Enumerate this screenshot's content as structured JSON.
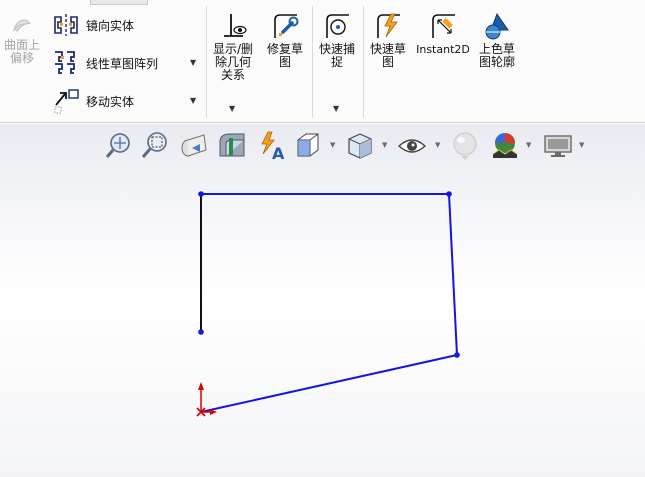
{
  "ribbon": {
    "surface_offset": {
      "label_line1": "曲面上",
      "label_line2": "偏移",
      "enabled": false
    },
    "mirror_entities": {
      "label": "镜向实体"
    },
    "linear_pattern": {
      "label": "线性草图阵列"
    },
    "move_entities": {
      "label": "移动实体"
    },
    "display_relations": {
      "label_line1": "显示/删",
      "label_line2": "除几何",
      "label_line3": "关系"
    },
    "repair_sketch": {
      "label_line1": "修复草",
      "label_line2": "图"
    },
    "quick_snaps": {
      "label_line1": "快速捕",
      "label_line2": "捉"
    },
    "rapid_sketch": {
      "label_line1": "快速草",
      "label_line2": "图"
    },
    "instant2d": {
      "label": "Instant2D"
    },
    "shaded_contours": {
      "label_line1": "上色草",
      "label_line2": "图轮廓"
    }
  },
  "heads_up_toolbar": {
    "icons": [
      "zoom-to-fit-icon",
      "zoom-to-area-icon",
      "previous-view-icon",
      "section-view-icon",
      "dynamic-annotation-icon",
      "view-orientation-icon",
      "display-style-icon",
      "hide-show-items-icon",
      "edit-appearance-icon",
      "apply-scene-icon",
      "view-settings-icon"
    ]
  },
  "colors": {
    "sketch_blue": "#1414e6",
    "sketch_black": "#111111",
    "origin_red": "#e00000",
    "accent_orange": "#f0a020"
  }
}
